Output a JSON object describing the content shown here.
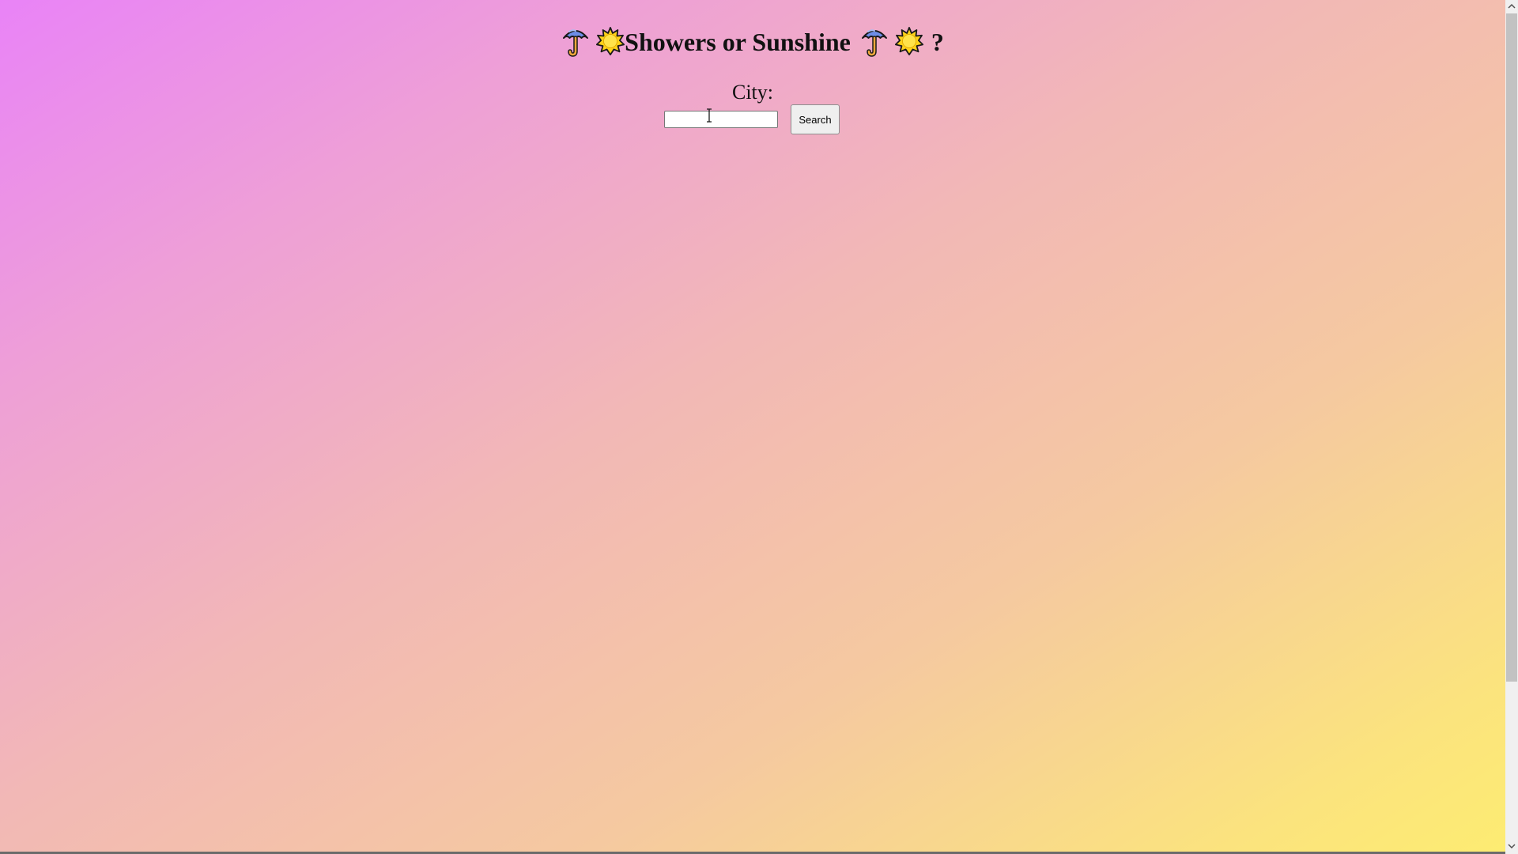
{
  "header": {
    "title": "Showers or Sunshine",
    "trailing": "?",
    "icons": [
      "umbrella-icon",
      "sun-icon",
      "umbrella-icon",
      "sun-icon"
    ]
  },
  "search": {
    "label": "City:",
    "value": "",
    "placeholder": "",
    "button_label": "Search"
  },
  "colors": {
    "gradient_start": "#e983f7",
    "gradient_mid": "#f2b8b6",
    "gradient_end": "#fdec72",
    "text": "#111111",
    "umbrella_canopy": "#6d8de8",
    "umbrella_handle": "#f2a93b",
    "sun": "#ffd21a"
  },
  "scrollbar": {
    "position_fraction": 0.0
  }
}
